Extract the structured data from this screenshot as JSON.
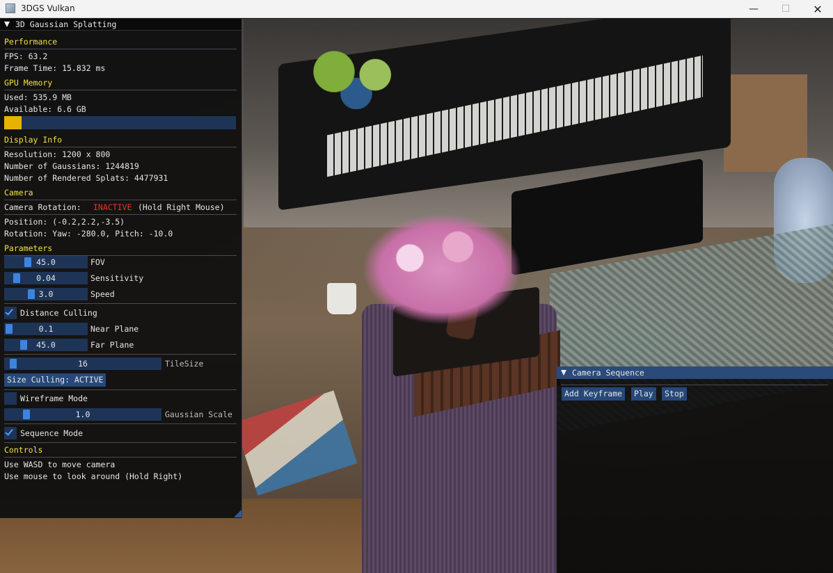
{
  "window": {
    "title": "3DGS Vulkan",
    "icons": [
      "app-icon",
      "minimize-icon",
      "maximize-icon",
      "close-icon"
    ]
  },
  "panel": {
    "title": "3D Gaussian Splatting",
    "performance": {
      "header": "Performance",
      "fps": "FPS: 63.2",
      "frame_time": "Frame Time: 15.832 ms"
    },
    "gpu_memory": {
      "header": "GPU Memory",
      "used": "Used: 535.9 MB",
      "available": "Available: 6.6 GB",
      "usage_fraction": 0.075,
      "bar_color": "#e6b400"
    },
    "display_info": {
      "header": "Display Info",
      "resolution": "Resolution: 1200 x 800",
      "gaussians": "Number of Gaussians: 1244819",
      "rendered_splats": "Number of Rendered Splats: 4477931"
    },
    "camera": {
      "header": "Camera",
      "rotation_label": "Camera Rotation:",
      "rotation_state": "INACTIVE",
      "rotation_hint": "(Hold Right Mouse)",
      "position": "Position: (-0.2,2.2,-3.5)",
      "rotation": "Rotation: Yaw: -280.0, Pitch: -10.0"
    },
    "parameters": {
      "header": "Parameters",
      "fov": {
        "value": "45.0",
        "label": "FOV",
        "fraction": 0.25
      },
      "sensitivity": {
        "value": "0.04",
        "label": "Sensitivity",
        "fraction": 0.1
      },
      "speed": {
        "value": "3.0",
        "label": "Speed",
        "fraction": 0.3
      },
      "distance_culling": {
        "label": "Distance Culling",
        "checked": true
      },
      "near_plane": {
        "value": "0.1",
        "label": "Near Plane",
        "fraction": 0.0
      },
      "far_plane": {
        "value": "45.0",
        "label": "Far Plane",
        "fraction": 0.2
      },
      "tile_size": {
        "value": "16",
        "label": "TileSize",
        "fraction": 0.03
      },
      "size_culling_button": "Size Culling: ACTIVE",
      "wireframe": {
        "label": "Wireframe Mode",
        "checked": false
      },
      "gaussian_scale": {
        "value": "1.0",
        "label": "Gaussian Scale",
        "fraction": 0.12
      },
      "sequence_mode": {
        "label": "Sequence Mode",
        "checked": true
      }
    },
    "controls": {
      "header": "Controls",
      "line1": "Use WASD to move camera",
      "line2": "Use mouse to look around (Hold Right)"
    }
  },
  "sequence_window": {
    "title": "Camera Sequence",
    "buttons": {
      "add_keyframe": "Add Keyframe",
      "play": "Play",
      "stop": "Stop"
    }
  },
  "colors": {
    "header_yellow": "#f2e23e",
    "inactive_red": "#f0302a",
    "slider_bg": "#1e3457",
    "slider_grab": "#3d84e0",
    "button": "#26487a"
  }
}
